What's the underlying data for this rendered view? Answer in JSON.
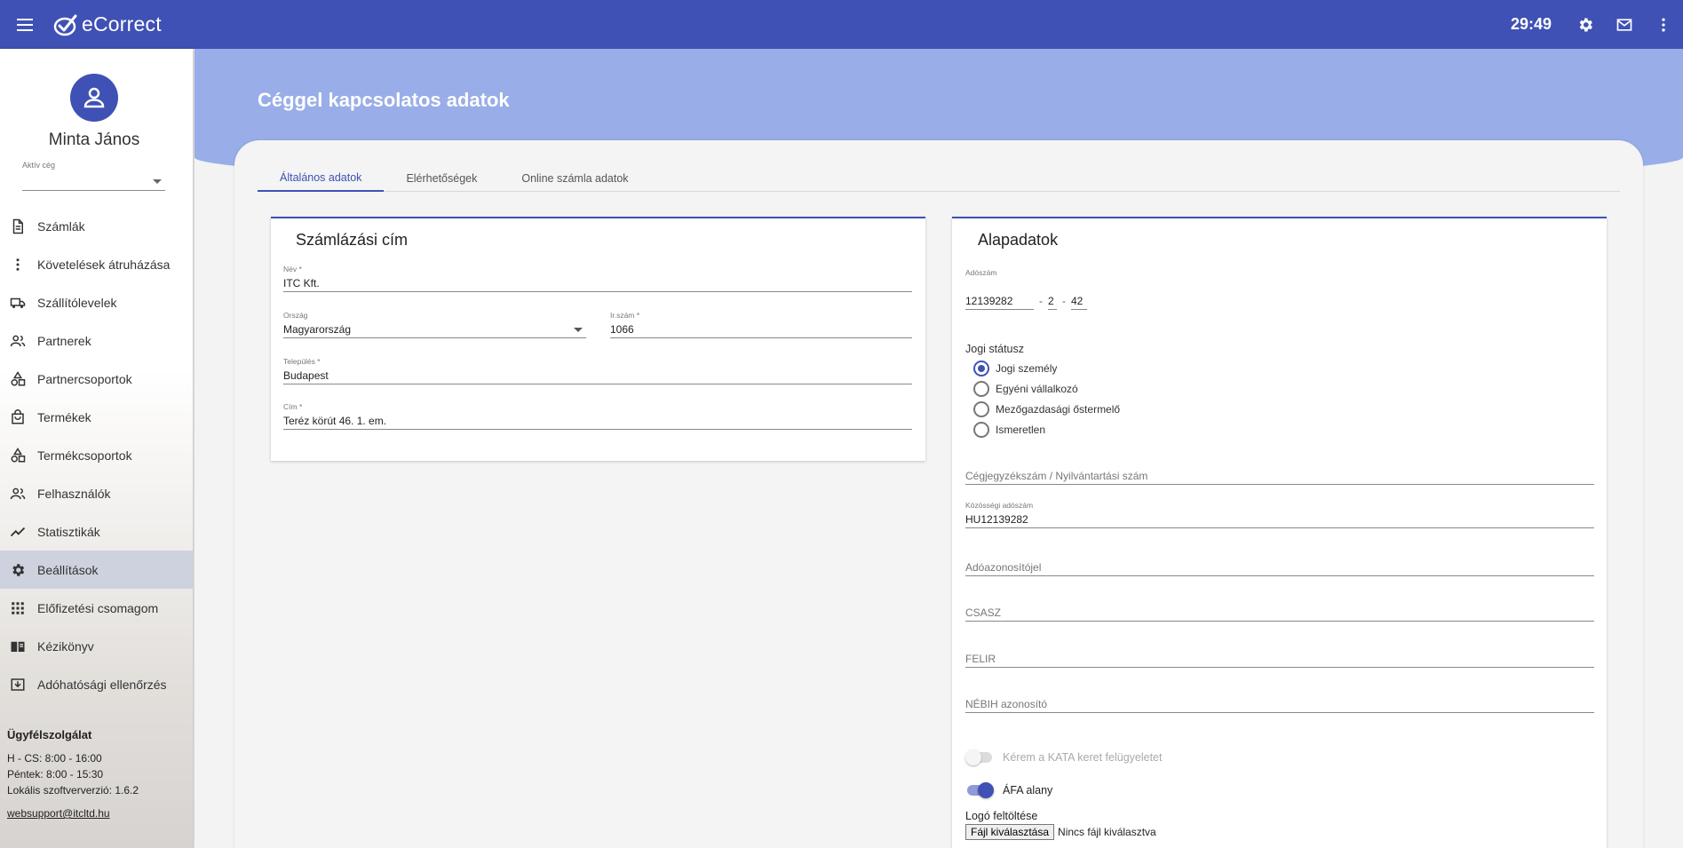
{
  "topbar": {
    "brand": "eCorrect",
    "timer": "29:49",
    "icons": [
      "menu-icon",
      "settings-icon",
      "mail-icon",
      "more-vertical-icon"
    ]
  },
  "sidebar": {
    "user_name": "Minta János",
    "company_label": "Aktív cég",
    "company_value": "",
    "items": [
      {
        "label": "Számlák",
        "icon": "document-icon"
      },
      {
        "label": "Követelések átruházása",
        "icon": "more-vertical-icon"
      },
      {
        "label": "Szállítólevelek",
        "icon": "truck-icon"
      },
      {
        "label": "Partnerek",
        "icon": "people-icon"
      },
      {
        "label": "Partnercsoportok",
        "icon": "shapes-icon"
      },
      {
        "label": "Termékek",
        "icon": "shopping-bag-icon"
      },
      {
        "label": "Termékcsoportok",
        "icon": "shapes-icon"
      },
      {
        "label": "Felhasználók",
        "icon": "people-icon"
      },
      {
        "label": "Statisztikák",
        "icon": "trending-icon"
      },
      {
        "label": "Beállítások",
        "icon": "gear-icon",
        "active": true
      },
      {
        "label": "Előfizetési csomagom",
        "icon": "apps-grid-icon"
      },
      {
        "label": "Kézikönyv",
        "icon": "book-icon"
      },
      {
        "label": "Adóhatósági ellenőrzés",
        "icon": "archive-icon"
      }
    ],
    "support": {
      "title": "Ügyfélszolgálat",
      "line1": "H - CS: 8:00 - 16:00",
      "line2": "Péntek: 8:00 - 15:30",
      "line3": "Lokális szoftververzió: 1.6.2",
      "email": "websupport@itcltd.hu"
    }
  },
  "main": {
    "page_title": "Céggel kapcsolatos adatok",
    "tabs": [
      {
        "label": "Általános adatok",
        "active": true
      },
      {
        "label": "Elérhetőségek"
      },
      {
        "label": "Online számla adatok"
      }
    ],
    "billing": {
      "title": "Számlázási cím",
      "name_label": "Név *",
      "name_value": "ITC Kft.",
      "country_label": "Ország",
      "country_value": "Magyarország",
      "zip_label": "Ir.szám *",
      "zip_value": "1066",
      "city_label": "Település *",
      "city_value": "Budapest",
      "address_label": "Cím *",
      "address_value": "Teréz körút 46. 1. em."
    },
    "basic": {
      "title": "Alapadatok",
      "tax_label": "Adószám",
      "tax_part1": "12139282",
      "tax_part2": "2",
      "tax_part3": "42",
      "tax_sep": "-",
      "legal_status_label": "Jogi státusz",
      "legal_options": [
        "Jogi személy",
        "Egyéni vállalkozó",
        "Mezőgazdasági őstermelő",
        "Ismeretlen"
      ],
      "legal_selected": 0,
      "reg_placeholder": "Cégjegyzékszám / Nyilvántartási szám",
      "eu_tax_label": "Közösségi adószám",
      "eu_tax_value": "HU12139282",
      "tax_id_placeholder": "Adóazonosítójel",
      "csasz_placeholder": "CSASZ",
      "felir_placeholder": "FELIR",
      "nebih_placeholder": "NÉBIH azonosító",
      "kata_label": "Kérem a KATA keret felügyeletet",
      "kata_on": false,
      "afa_label": "ÁFA alany",
      "afa_on": true,
      "logo_upload_label": "Logó feltöltése",
      "file_button": "Fájl kiválasztása",
      "file_status": "Nincs fájl kiválasztva"
    }
  },
  "colors": {
    "primary": "#3f51b5",
    "banner": "#99ade8"
  }
}
